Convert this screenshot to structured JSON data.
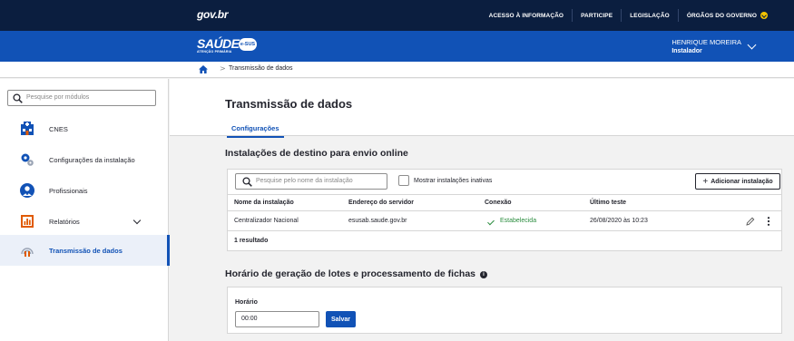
{
  "govbar": {
    "logo": "gov.br",
    "links": [
      "ACESSO À INFORMAÇÃO",
      "PARTICIPE",
      "LEGISLAÇÃO",
      "ÓRGÃOS DO GOVERNO"
    ]
  },
  "header": {
    "brand": "SAÚDE",
    "brand_sub": "ATENÇÃO PRIMÁRIA",
    "esus": "e-SUS",
    "user_name": "HENRIQUE MOREIRA",
    "user_role": "Instalador"
  },
  "breadcrumb": {
    "separator": ">",
    "current": "Transmissão de dados"
  },
  "sidebar": {
    "search_placeholder": "Pesquise por módulos",
    "items": [
      {
        "label": "CNES",
        "icon": "cnes-icon"
      },
      {
        "label": "Configurações da instalação",
        "icon": "settings-gears-icon"
      },
      {
        "label": "Profissionais",
        "icon": "professional-icon"
      },
      {
        "label": "Relatórios",
        "icon": "report-chart-icon"
      },
      {
        "label": "Transmissão de dados",
        "icon": "transmission-icon"
      }
    ]
  },
  "page": {
    "title": "Transmissão de dados",
    "tab": "Configurações"
  },
  "destinations": {
    "title": "Instalações de destino para envio online",
    "search_placeholder": "Pesquise pelo nome da instalação",
    "show_inactive_label": "Mostrar instalações inativas",
    "add_button": "Adicionar instalação",
    "columns": [
      "Nome da instalação",
      "Endereço do servidor",
      "Conexão",
      "Último teste"
    ],
    "rows": [
      {
        "name": "Centralizador Nacional",
        "server": "esusab.saude.gov.br",
        "connection": "Estabelecida",
        "last_test": "26/08/2020 às 10:23"
      }
    ],
    "result_count": "1 resultado"
  },
  "schedule": {
    "title": "Horário de geração de lotes e processamento de fichas",
    "info_glyph": "i",
    "field_label": "Horário",
    "field_value": "00:00",
    "save_button": "Salvar"
  },
  "colors": {
    "govbar": "#0b1e3f",
    "header": "#1152b6",
    "accent": "#1152b6",
    "success": "#2a8c3e"
  }
}
